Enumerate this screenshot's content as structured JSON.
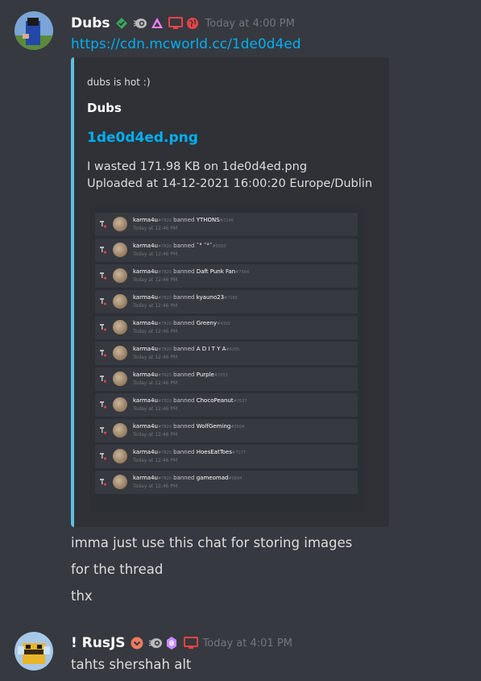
{
  "message1": {
    "username": "Dubs",
    "timestamp": "Today at 4:00 PM",
    "link": "https://cdn.mcworld.cc/1de0d4ed",
    "embed": {
      "provider": "dubs is hot :)",
      "author": "Dubs",
      "title": "1de0d4ed.png",
      "description_line1": "I wasted 171.98 KB on 1de0d4ed.png",
      "description_line2": "Uploaded at 14-12-2021 16:00:20 Europe/Dublin",
      "accent_color": "#5bc0de",
      "image_rows": [
        {
          "actor": "karma4u",
          "actor_tag": "#7820",
          "action": "banned",
          "target": "YTHONS",
          "target_tag": "#7246",
          "time": "Today at 12:46 PM"
        },
        {
          "actor": "karma4u",
          "actor_tag": "#7820",
          "action": "banned",
          "target": "ˆ° ˆ°ˆ",
          "target_tag": "#5503",
          "time": "Today at 12:46 PM"
        },
        {
          "actor": "karma4u",
          "actor_tag": "#7820",
          "action": "banned",
          "target": "Daft Punk Fan",
          "target_tag": "#7664",
          "time": "Today at 12:46 PM"
        },
        {
          "actor": "karma4u",
          "actor_tag": "#7820",
          "action": "banned",
          "target": "kyauno23",
          "target_tag": "#7165",
          "time": "Today at 12:46 PM"
        },
        {
          "actor": "karma4u",
          "actor_tag": "#7820",
          "action": "banned",
          "target": "Greeny",
          "target_tag": "#4392",
          "time": "Today at 12:46 PM"
        },
        {
          "actor": "karma4u",
          "actor_tag": "#7820",
          "action": "banned",
          "target": "A D I T Y A",
          "target_tag": "#6255",
          "time": "Today at 12:46 PM"
        },
        {
          "actor": "karma4u",
          "actor_tag": "#7820",
          "action": "banned",
          "target": "Purple",
          "target_tag": "#2053",
          "time": "Today at 12:46 PM"
        },
        {
          "actor": "karma4u",
          "actor_tag": "#7820",
          "action": "banned",
          "target": "ChocoPeanut",
          "target_tag": "#7637",
          "time": "Today at 12:46 PM"
        },
        {
          "actor": "karma4u",
          "actor_tag": "#7820",
          "action": "banned",
          "target": "WolfGeming",
          "target_tag": "#0504",
          "time": "Today at 12:46 PM"
        },
        {
          "actor": "karma4u",
          "actor_tag": "#7820",
          "action": "banned",
          "target": "HoesEatToes",
          "target_tag": "#7177",
          "time": "Today at 12:46 PM"
        },
        {
          "actor": "karma4u",
          "actor_tag": "#7820",
          "action": "banned",
          "target": "gameomad",
          "target_tag": "#0894",
          "time": "Today at 12:46 PM"
        }
      ]
    },
    "followups": [
      "imma just use this chat for storing images",
      "for the thread",
      "thx"
    ]
  },
  "message2": {
    "username": "! RusJS",
    "timestamp": "Today at 4:01 PM",
    "text": "tahts shershah alt"
  },
  "icons": {
    "verified": "verified-badge-icon",
    "hypesquad": "hypesquad-icon",
    "nitro": "nitro-icon",
    "desktop": "desktop-icon",
    "web": "web-icon"
  },
  "colors": {
    "background": "#36393f",
    "embed_bg": "#2f3136",
    "link": "#00aff4",
    "timestamp": "#72767d",
    "status_red": "#ed4245"
  }
}
